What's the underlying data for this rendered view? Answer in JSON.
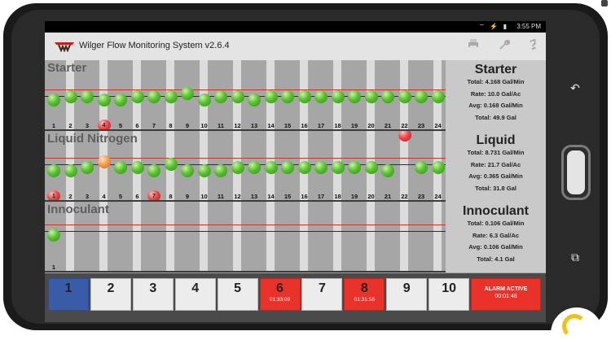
{
  "statusbar": {
    "icons": "⌔ ⚡ ▮",
    "time": "3:55 PM"
  },
  "app": {
    "title": "Wilger Flow Monitoring System v2.6.4"
  },
  "toolbar": {
    "icons": [
      "printer-icon",
      "wrench-icon",
      "help-icon",
      "overflow-menu-icon"
    ]
  },
  "colors": {
    "alarm_red": "#e8322a",
    "selected_blue": "#3a5ca8",
    "flow_green": "#59c22f",
    "warning_orange": "#f3a050"
  },
  "sections": [
    {
      "title": "Starter",
      "rows": [
        "1",
        "2",
        "3",
        "4",
        "5",
        "6",
        "7",
        "8",
        "9",
        "10",
        "11",
        "12",
        "13",
        "14",
        "15",
        "16",
        "17",
        "18",
        "19",
        "20",
        "21",
        "22",
        "23",
        "24"
      ],
      "alarm_rows": [
        "4"
      ],
      "panel": {
        "title": "Starter",
        "total": "Total: 4.168 Gal/Min",
        "rate": "Rate: 10.0 Gal/Ac",
        "avg": "Avg: 0.168 Gal/Min",
        "total_volume": "Total: 49.9 Gal"
      }
    },
    {
      "title": "Liquid Nitrogen",
      "rows": [
        "1",
        "2",
        "3",
        "4",
        "5",
        "6",
        "7",
        "8",
        "9",
        "10",
        "11",
        "12",
        "13",
        "14",
        "15",
        "16",
        "17",
        "18",
        "19",
        "20",
        "21",
        "22",
        "23",
        "24"
      ],
      "alarm_rows": [
        "1",
        "7"
      ],
      "panel": {
        "title": "Liquid",
        "total": "Total: 8.731 Gal/Min",
        "rate": "Rate: 21.7 Gal/Ac",
        "avg": "Avg: 0.365 Gal/Min",
        "total_volume": "Total: 31.8 Gal"
      }
    },
    {
      "title": "Innoculant",
      "rows": [
        "1"
      ],
      "alarm_rows": [],
      "panel": {
        "title": "Innoculant",
        "total": "Total: 0.106 Gal/Min",
        "rate": "Rate: 6.3 Gal/Ac",
        "avg": "Avg: 0.106 Gal/Min",
        "total_volume": "Total: 4.1 Gal"
      }
    }
  ],
  "bottom_buttons": [
    {
      "label": "1",
      "time": "",
      "state": "selected"
    },
    {
      "label": "2",
      "time": "",
      "state": "normal"
    },
    {
      "label": "3",
      "time": "",
      "state": "normal"
    },
    {
      "label": "4",
      "time": "",
      "state": "normal"
    },
    {
      "label": "5",
      "time": "",
      "state": "normal"
    },
    {
      "label": "6",
      "time": "01:33:09",
      "state": "alarm"
    },
    {
      "label": "7",
      "time": "",
      "state": "normal"
    },
    {
      "label": "8",
      "time": "01:31:58",
      "state": "alarm"
    },
    {
      "label": "9",
      "time": "",
      "state": "normal"
    },
    {
      "label": "10",
      "time": "",
      "state": "normal"
    }
  ],
  "alarm": {
    "label": "ALARM ACTIVE",
    "time": "00:01:48"
  },
  "device_nav": {
    "back": "↶",
    "recents": "⧉"
  }
}
